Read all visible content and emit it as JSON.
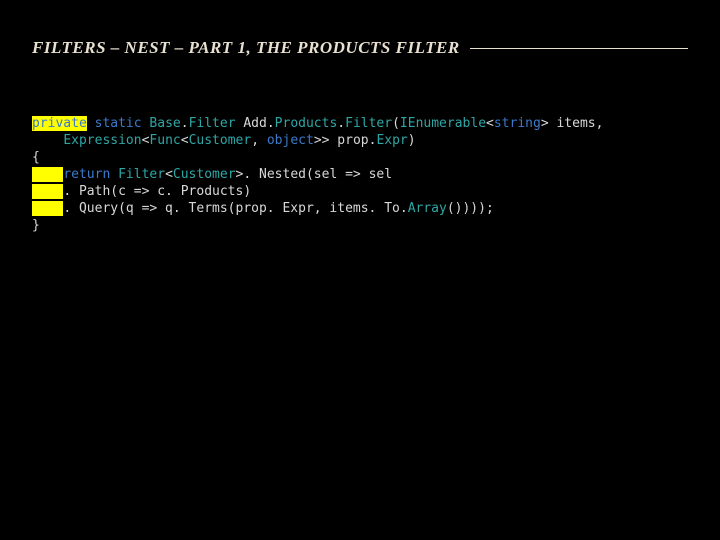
{
  "slide": {
    "title": "FILTERS – NEST – PART 1, THE PRODUCTS FILTER"
  },
  "code": {
    "l1_kw1": "private",
    "l1_sp1": " ",
    "l1_kw2": "static",
    "l1_sp2": " ",
    "l1_t1": "Base",
    "l1_txt3": ".",
    "l1_t2": "Filter",
    "l1_txt4": " Add.",
    "l1_t3": "Products",
    "l1_txt5": ".",
    "l1_t4": "Filter",
    "l1_txt6": "(",
    "l1_t5": "IEnumerable",
    "l1_txt7": "<",
    "l1_kw3": "string",
    "l1_txt8": "> items,",
    "l2_pad": "    ",
    "l2_t1": "Expression",
    "l2_txt1": "<",
    "l2_t2": "Func",
    "l2_txt2": "<",
    "l2_t3": "Customer",
    "l2_txt3": ", ",
    "l2_kw1": "object",
    "l2_txt4": ">> prop.",
    "l2_t4": "Expr",
    "l2_txt5": ")",
    "l3": "{",
    "l4_pad": "    ",
    "l4_kw1": "return",
    "l4_sp1": " ",
    "l4_t1": "Filter",
    "l4_txt2": "<",
    "l4_t2": "Customer",
    "l4_txt3": ">. Nested(sel => sel",
    "l5_pad": "    ",
    "l5_txt1": ". Path(c => c. Products)",
    "l6_pad": "    ",
    "l6_txt1": ". Query(q => q. Terms(prop. Expr, items. To.",
    "l6_t1": "Array",
    "l6_txt2": "())));",
    "l7": "}"
  }
}
